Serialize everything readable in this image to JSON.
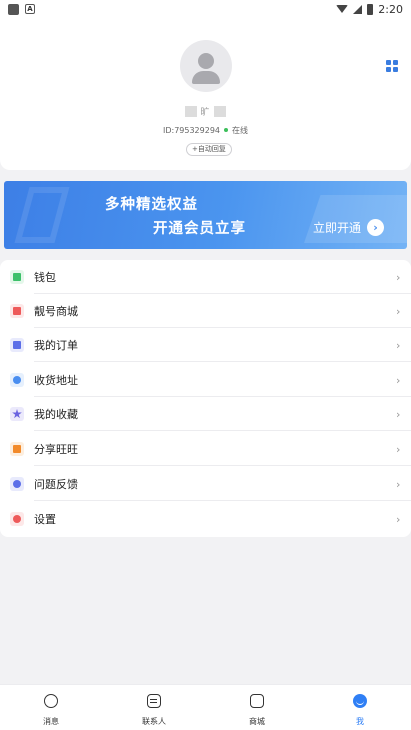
{
  "status_bar": {
    "time": "2:20"
  },
  "profile": {
    "nickname_hint": "旷",
    "id_text": "ID:795329294",
    "status_text": "在线",
    "auto_reply_label": "+自动回复"
  },
  "banner": {
    "line1": "多种精选权益",
    "line2": "开通会员立享",
    "button_label": "立即开通",
    "button_arrow": "›"
  },
  "menu": {
    "items": [
      {
        "label": "钱包",
        "icon": "wallet-icon",
        "color": "#3cc06a"
      },
      {
        "label": "靓号商城",
        "icon": "store-icon",
        "color": "#ee5a5a"
      },
      {
        "label": "我的订单",
        "icon": "order-icon",
        "color": "#5b6ee8"
      },
      {
        "label": "收货地址",
        "icon": "address-icon",
        "color": "#4a8ef0"
      },
      {
        "label": "我的收藏",
        "icon": "favorite-icon",
        "color": "#6a63e0"
      },
      {
        "label": "分享旺旺",
        "icon": "share-icon",
        "color": "#f28a2a"
      },
      {
        "label": "问题反馈",
        "icon": "feedback-icon",
        "color": "#5b6ee8"
      },
      {
        "label": "设置",
        "icon": "settings-icon",
        "color": "#ee5a5a"
      }
    ],
    "chevron": "›"
  },
  "tabbar": {
    "tabs": [
      {
        "label": "消息",
        "icon": "message-icon",
        "active": false
      },
      {
        "label": "联系人",
        "icon": "contacts-icon",
        "active": false
      },
      {
        "label": "商城",
        "icon": "shop-icon",
        "active": false
      },
      {
        "label": "我",
        "icon": "me-icon",
        "active": true
      }
    ]
  },
  "colors": {
    "accent": "#2f7ff5",
    "banner_start": "#3d7fe6",
    "online": "#3cbf5a"
  }
}
